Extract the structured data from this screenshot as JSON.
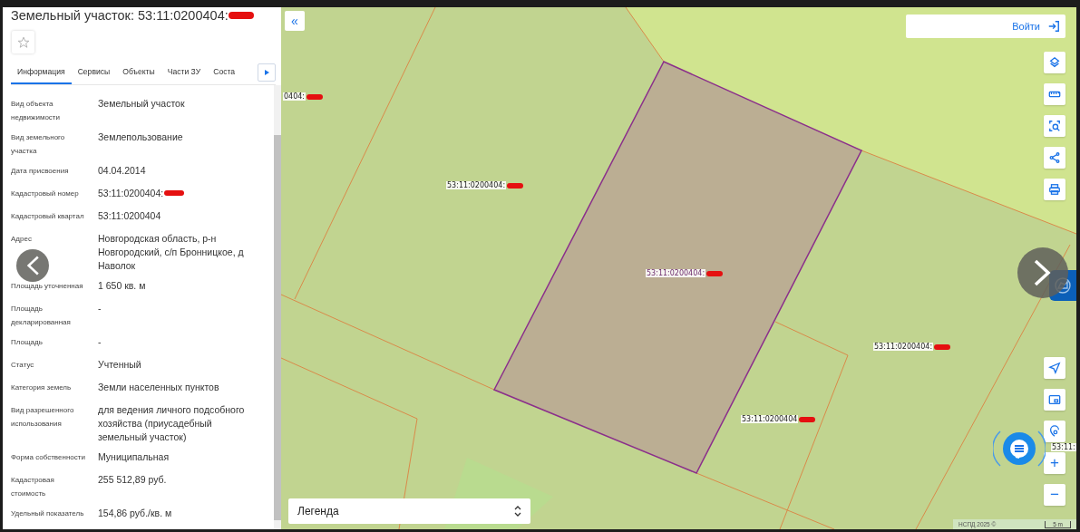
{
  "panel": {
    "title": "Земельный участок: 53:11:0200404:",
    "favorite": false,
    "tabs": [
      {
        "label": "Информация",
        "selected": true
      },
      {
        "label": "Сервисы",
        "selected": false
      },
      {
        "label": "Объекты",
        "selected": false
      },
      {
        "label": "Части ЗУ",
        "selected": false
      },
      {
        "label": "Соста",
        "selected": false
      }
    ],
    "rows": [
      {
        "label": "Вид объекта недвижимости",
        "value": "Земельный участок"
      },
      {
        "label": "Вид земельного участка",
        "value": "Землепользование"
      },
      {
        "label": "Дата присвоения",
        "value": "04.04.2014"
      },
      {
        "label": "Кадастровый номер",
        "value": "53:11:0200404:",
        "redacted": true
      },
      {
        "label": "Кадастровый квартал",
        "value": "53:11:0200404"
      },
      {
        "label": "Адрес",
        "value": "Новгородская область, р-н Новгородский, с/п Бронницкое, д Наволок"
      },
      {
        "label": "Площадь уточненная",
        "value": "1 650 кв. м"
      },
      {
        "label": "Площадь декларированная",
        "value": "-"
      },
      {
        "label": "Площадь",
        "value": "-"
      },
      {
        "label": "Статус",
        "value": "Учтенный"
      },
      {
        "label": "Категория земель",
        "value": "Земли населенных пунктов"
      },
      {
        "label": "Вид разрешенного использования",
        "value": "для ведения личного подсобного хозяйства (приусадебный земельный участок)"
      },
      {
        "label": "Форма собственности",
        "value": "Муниципальная"
      },
      {
        "label": "Кадастровая стоимость",
        "value": "255 512,89 руб."
      },
      {
        "label": "Удельный показатель",
        "value": "154,86 руб./кв. м"
      }
    ]
  },
  "map": {
    "toggle": "«",
    "login": "Войти",
    "labels": [
      {
        "text": "0404:",
        "selected": false,
        "redacted": true
      },
      {
        "text": "53:11:0200404:",
        "selected": false,
        "redacted": true
      },
      {
        "text": "53:11:0200404:",
        "selected": true,
        "redacted": true
      },
      {
        "text": "53:11:0200404:",
        "selected": false,
        "redacted": true
      },
      {
        "text": "53:11:0200404",
        "selected": false,
        "redacted": true
      },
      {
        "text": "53:11:",
        "selected": false,
        "redacted": false
      }
    ],
    "zoom": [
      "+",
      "−"
    ],
    "legend": "Легенда",
    "attribution": "НСПД 2025 ©",
    "scale": "5 m"
  }
}
